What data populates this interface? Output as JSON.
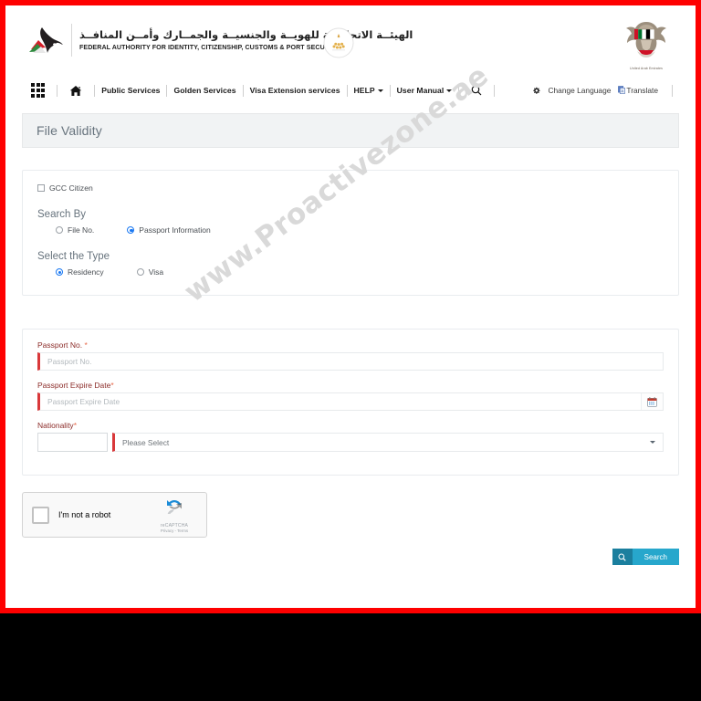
{
  "header": {
    "brand_arabic": "الهيئــة الاتحاديــة للهويــة والجنسيــة والجمــارك وأمــن المنافــذ",
    "brand_english": "FEDERAL AUTHORITY FOR IDENTITY, CITIZENSHIP, CUSTOMS & PORT SECURITY",
    "emblem_caption": "United Arab Emirates"
  },
  "nav": {
    "apps_icon": "grid-apps-icon",
    "home_icon": "home-icon",
    "search_icon": "search-icon",
    "items": [
      {
        "label": "Public Services",
        "has_caret": false
      },
      {
        "label": "Golden Services",
        "has_caret": false
      },
      {
        "label": "Visa Extension services",
        "has_caret": false
      },
      {
        "label": "HELP",
        "has_caret": true
      },
      {
        "label": "User Manual",
        "has_caret": true
      }
    ],
    "change_language": "Change Language",
    "translate": "Translate",
    "gear_icon": "gear-icon",
    "translate_icon": "translate-icon"
  },
  "page": {
    "title": "File Validity",
    "watermark": "www.Proactivezone.ae"
  },
  "search_panel": {
    "gcc_checkbox_label": "GCC Citizen",
    "gcc_checked": false,
    "search_by_heading": "Search By",
    "search_by_options": [
      {
        "label": "File No.",
        "selected": false
      },
      {
        "label": "Passport Information",
        "selected": true
      }
    ],
    "select_type_heading": "Select the Type",
    "type_options": [
      {
        "label": "Residency",
        "selected": true
      },
      {
        "label": "Visa",
        "selected": false
      }
    ]
  },
  "fields": {
    "passport_no": {
      "label": "Passport No. ",
      "required_mark": "*",
      "placeholder": "Passport No.",
      "value": ""
    },
    "passport_expire": {
      "label": "Passport Expire Date",
      "required_mark": "*",
      "placeholder": "Passport Expire Date",
      "value": "",
      "icon": "calendar-icon"
    },
    "nationality": {
      "label": "Nationality",
      "required_mark": "*",
      "code_value": "",
      "code_placeholder": "",
      "select_value": "Please Select",
      "caret_icon": "chevron-down-icon"
    }
  },
  "recaptcha": {
    "label": "I'm not a robot",
    "brand": "reCAPTCHA",
    "links": "Privacy - Terms",
    "checked": false
  },
  "actions": {
    "search_label": "Search",
    "search_icon": "search-icon"
  },
  "colors": {
    "frame_red": "#fe0000",
    "title_band_bg": "#f1f3f4",
    "required_border": "#d9383a",
    "label_red": "#8b2b28",
    "radio_blue": "#1877f2",
    "button_teal": "#27a7cc",
    "button_teal_dark": "#1b7f9e"
  }
}
